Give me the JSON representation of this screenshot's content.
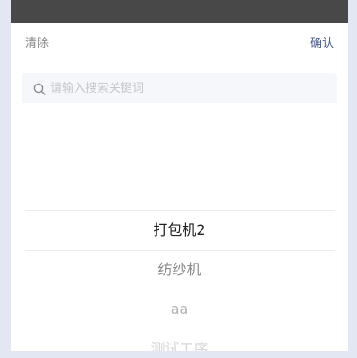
{
  "header": {
    "clear_label": "清除",
    "confirm_label": "确认"
  },
  "search": {
    "placeholder": "请输入搜索关键词",
    "value": ""
  },
  "picker": {
    "options": [
      "打包机2",
      "纺纱机",
      "aa",
      "测试工序"
    ],
    "selected_index": 0
  },
  "colors": {
    "topbar": "#484848",
    "confirm": "#4a5a8c",
    "page_background": "#e3e7f3"
  }
}
